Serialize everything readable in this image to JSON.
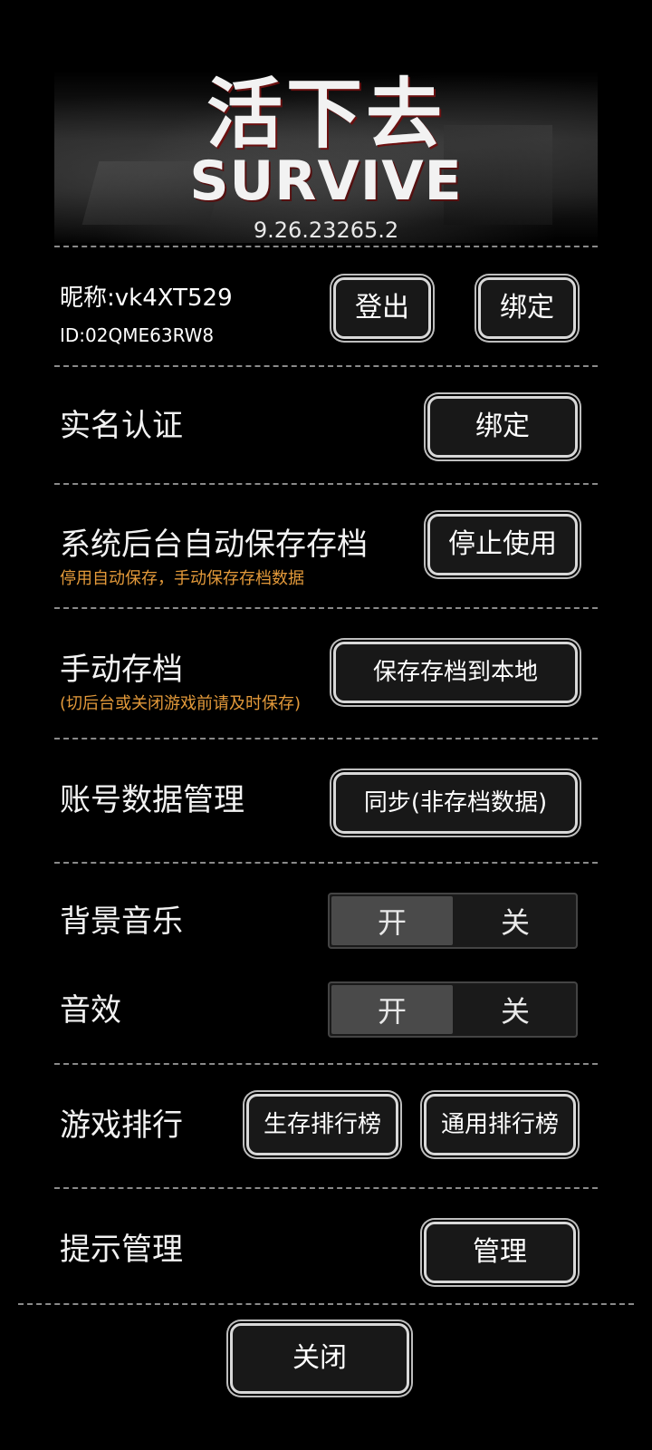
{
  "header": {
    "title_cn": "活下去",
    "title_en": "SURVIVE",
    "version": "9.26.23265.2"
  },
  "account": {
    "nickname": "昵称:vk4XT529",
    "id": "ID:02QME63RW8",
    "logout_label": "登出",
    "bind_label": "绑定"
  },
  "realname": {
    "label": "实名认证",
    "button_label": "绑定"
  },
  "autosave": {
    "label": "系统后台自动保存存档",
    "hint": "停用自动保存，手动保存存档数据",
    "button_label": "停止使用"
  },
  "manual_save": {
    "label": "手动存档",
    "hint": "(切后台或关闭游戏前请及时保存)",
    "button_label": "保存存档到本地"
  },
  "account_data": {
    "label": "账号数据管理",
    "button_label": "同步(非存档数据)"
  },
  "bgm": {
    "label": "背景音乐",
    "on_label": "开",
    "off_label": "关",
    "state": "on"
  },
  "sfx": {
    "label": "音效",
    "on_label": "开",
    "off_label": "关",
    "state": "on"
  },
  "ranking": {
    "label": "游戏排行",
    "survival_label": "生存排行榜",
    "general_label": "通用排行榜"
  },
  "tips": {
    "label": "提示管理",
    "button_label": "管理"
  },
  "footer": {
    "close_label": "关闭"
  }
}
